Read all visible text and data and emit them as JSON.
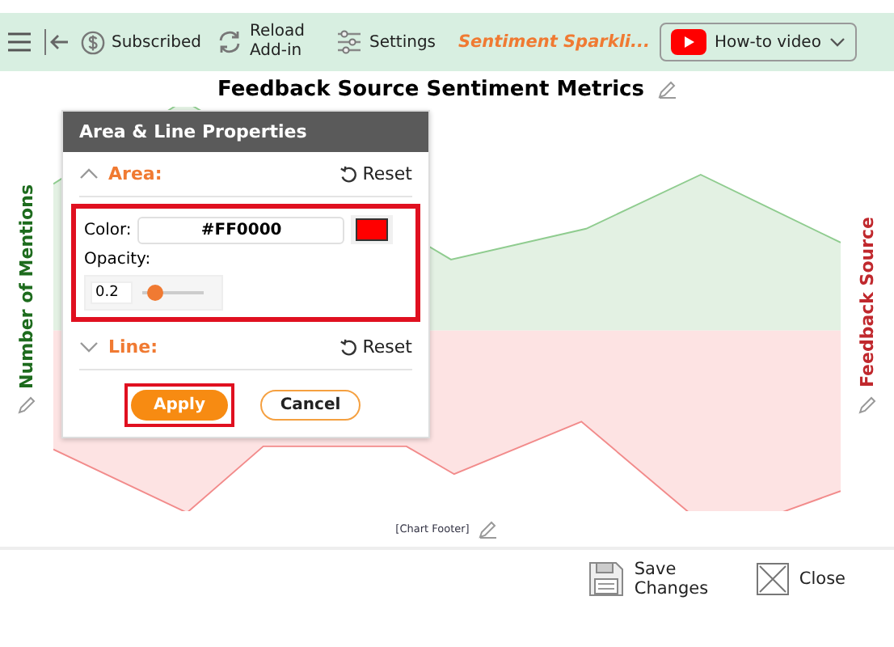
{
  "toolbar": {
    "subscription": "Subscribed",
    "reload": "Reload Add-in",
    "settings": "Settings",
    "brand": "Sentiment Sparkli...",
    "video_button": "How-to video"
  },
  "chart": {
    "title": "Feedback Source Sentiment Metrics",
    "y_axis_title": "Number of Mentions",
    "secondary_axis_title": "Feedback Source",
    "footer": "[Chart Footer]"
  },
  "dialog": {
    "title": "Area & Line Properties",
    "sections": [
      {
        "label": "Area:",
        "expanded": true,
        "reset": "Reset"
      },
      {
        "label": "Line:",
        "expanded": false,
        "reset": "Reset"
      }
    ],
    "fields_highlighted": true,
    "color_label": "Color:",
    "color_value": "#FF0000",
    "opacity_label": "Opacity:",
    "opacity_value": "0.2",
    "opacity": {
      "level": 0.2
    },
    "buttons": [
      {
        "kind": "primary",
        "label": "Apply",
        "highlighted": true
      },
      {
        "kind": "secondary",
        "label": "Cancel",
        "highlighted": false
      }
    ]
  },
  "footer": {
    "save": "Save Changes",
    "close": "Close"
  }
}
